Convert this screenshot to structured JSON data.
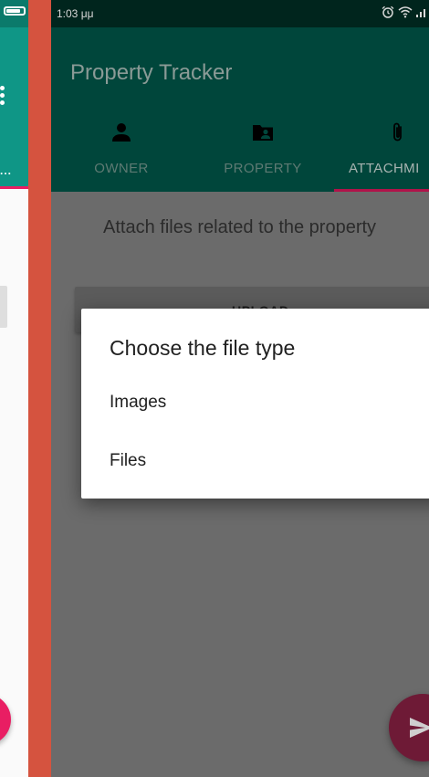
{
  "status_bar": {
    "time": "1:03 μμ",
    "icons": [
      "alarm-icon",
      "wifi-icon",
      "signal-icon"
    ]
  },
  "app_bar": {
    "title": "Property Tracker",
    "tabs": [
      {
        "label": "OWNER",
        "icon": "person-icon",
        "selected": false
      },
      {
        "label": "PROPERTY",
        "icon": "folder-shared-icon",
        "selected": false
      },
      {
        "label": "ATTACHMI",
        "icon": "paperclip-icon",
        "selected": true
      }
    ]
  },
  "content": {
    "hint": "Attach files related to the property",
    "upload_label": "UPLOAD"
  },
  "dialog": {
    "title": "Choose the file type",
    "options": [
      "Images",
      "Files"
    ]
  },
  "fab": {
    "icon": "send-icon"
  },
  "left_phone": {
    "ellipsis": "...",
    "icons": [
      "battery-icon",
      "more-vert-icon"
    ]
  },
  "colors": {
    "primary_dark": "#00251d",
    "primary": "#00463b",
    "accent": "#b0134a",
    "left_primary": "#0f9686",
    "left_accent": "#e91e63",
    "frame": "#d5533f"
  }
}
